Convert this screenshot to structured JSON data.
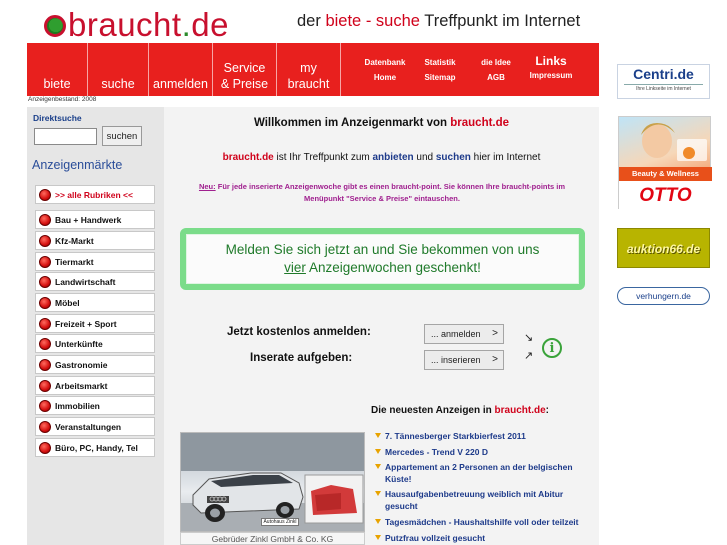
{
  "header": {
    "logo_main": "braucht",
    "logo_dot": ".",
    "logo_tld": "de",
    "tagline_pre": "der",
    "tagline_biete": "biete",
    "tagline_dash": "-",
    "tagline_suche": "suche",
    "tagline_post": "Treffpunkt im Internet"
  },
  "nav": {
    "items": [
      {
        "label": "biete"
      },
      {
        "label": "suche"
      },
      {
        "label": "anmelden"
      },
      {
        "line1": "Service",
        "line2": "& Preise"
      },
      {
        "line1": "my",
        "line2": "braucht"
      }
    ],
    "small": {
      "datenbank": "Datenbank",
      "home": "Home",
      "statistik": "Statistik",
      "sitemap": "Sitemap",
      "idee": "die Idee",
      "agb": "AGB",
      "links": "Links",
      "impressum": "Impressum"
    }
  },
  "bestand": "Anzeigenbestand: 2008",
  "sidebar": {
    "direktsuche": "Direktsuche",
    "search_value": "",
    "search_button": "suchen",
    "title": "Anzeigenmärkte",
    "categories": [
      ">> alle Rubriken <<",
      "Bau + Handwerk",
      "Kfz-Markt",
      "Tiermarkt",
      "Landwirtschaft",
      "Möbel",
      "Freizeit + Sport",
      "Unterkünfte",
      "Gastronomie",
      "Arbeitsmarkt",
      "Immobilien",
      "Veranstaltungen",
      "Büro, PC, Handy, Tel"
    ]
  },
  "main": {
    "welcome_pre": "Willkommen im Anzeigenmarkt von",
    "welcome_site": "braucht.de",
    "intro_site": "braucht.de",
    "intro_1": "ist Ihr Treffpunkt zum",
    "intro_anbieten": "anbieten",
    "intro_und": "und",
    "intro_suchen": "suchen",
    "intro_2": "hier im Internet",
    "news_label": "Neu:",
    "news_text": "Für jede inserierte Anzeigenwoche gibt es einen braucht-point. Sie können Ihre braucht-points im Menüpunkt \"Service & Preise\" eintauschen.",
    "promo_1": "Melden Sie sich jetzt an und Sie bekommen von uns",
    "promo_vier": "vier",
    "promo_2": "Anzeigenwochen geschenkt!",
    "register_label": "Jetzt kostenlos anmelden:",
    "register_button": "... anmelden",
    "post_label": "Inserate aufgeben:",
    "post_button": "... inserieren",
    "chevron": ">",
    "info_glyph": "i",
    "arrow_glyph": "↘",
    "arrow2_glyph": "↗",
    "latest_pre": "Die neuesten Anzeigen in",
    "latest_site": "braucht.de",
    "latest_colon": ":",
    "ads": [
      "7. Tännesberger Starkbierfest 2011",
      "Mercedes - Trend V 220 D",
      "Appartement an 2 Personen an der belgischen Küste!",
      "Hausaufgabenbetreuung weiblich mit Abitur gesucht",
      "Tagesmädchen - Haushaltshilfe voll oder teilzeit",
      "Putzfrau vollzeit gesucht"
    ],
    "car_caption": "Gebrüder Zinkl GmbH & Co. KG",
    "car_plate": "Autohaus Zinkl"
  },
  "right_ads": {
    "centri_big": "Centri.de",
    "centri_small": "Ihre Linkseite im Internet",
    "otto_band": "Beauty & Wellness",
    "otto_logo": "OTTO",
    "auktion": "auktion66.de",
    "verhungern": "verhungern.de"
  },
  "colors": {
    "brand_red": "#e8201e",
    "logo_red": "#c8102e",
    "link_blue": "#1d3a8a",
    "promo_green": "#7bdc8a"
  }
}
